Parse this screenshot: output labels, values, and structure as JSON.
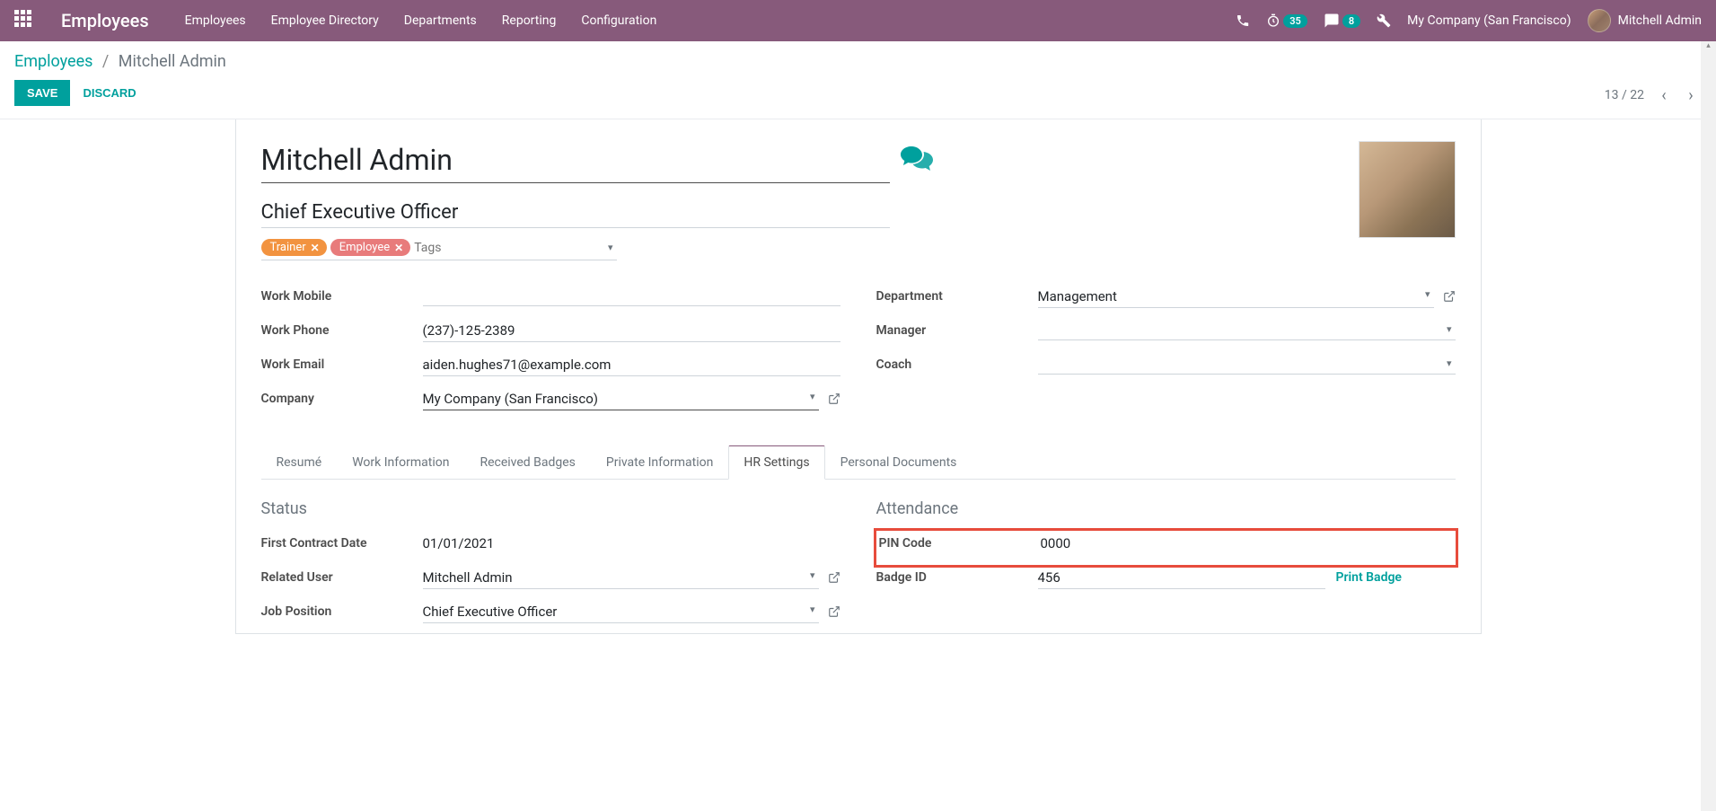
{
  "navbar": {
    "brand": "Employees",
    "menu": [
      "Employees",
      "Employee Directory",
      "Departments",
      "Reporting",
      "Configuration"
    ],
    "timer_badge": "35",
    "chat_badge": "8",
    "company": "My Company (San Francisco)",
    "user": "Mitchell Admin"
  },
  "breadcrumb": {
    "root": "Employees",
    "current": "Mitchell Admin"
  },
  "buttons": {
    "save": "SAVE",
    "discard": "DISCARD"
  },
  "pager": "13 / 22",
  "record": {
    "name": "Mitchell Admin",
    "job_title": "Chief Executive Officer",
    "tags": [
      {
        "label": "Trainer",
        "cls": "trainer"
      },
      {
        "label": "Employee",
        "cls": "employee"
      }
    ],
    "tags_placeholder": "Tags",
    "left_fields": {
      "work_mobile": {
        "label": "Work Mobile",
        "value": ""
      },
      "work_phone": {
        "label": "Work Phone",
        "value": "(237)-125-2389"
      },
      "work_email": {
        "label": "Work Email",
        "value": "aiden.hughes71@example.com"
      },
      "company": {
        "label": "Company",
        "value": "My Company (San Francisco)"
      }
    },
    "right_fields": {
      "department": {
        "label": "Department",
        "value": "Management"
      },
      "manager": {
        "label": "Manager",
        "value": ""
      },
      "coach": {
        "label": "Coach",
        "value": ""
      }
    }
  },
  "tabs": [
    "Resumé",
    "Work Information",
    "Received Badges",
    "Private Information",
    "HR Settings",
    "Personal Documents"
  ],
  "active_tab": 4,
  "hr_settings": {
    "status": {
      "heading": "Status",
      "first_contract": {
        "label": "First Contract Date",
        "value": "01/01/2021"
      },
      "related_user": {
        "label": "Related User",
        "value": "Mitchell Admin"
      },
      "job_position": {
        "label": "Job Position",
        "value": "Chief Executive Officer"
      }
    },
    "attendance": {
      "heading": "Attendance",
      "pin": {
        "label": "PIN Code",
        "value": "0000"
      },
      "badge": {
        "label": "Badge ID",
        "value": "456",
        "print": "Print Badge"
      }
    }
  }
}
